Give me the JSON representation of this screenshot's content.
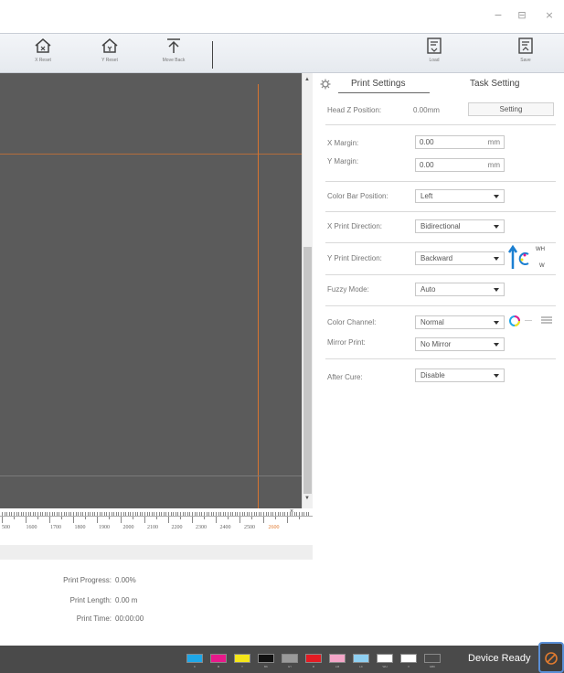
{
  "window": {
    "minimize": "−",
    "restore": "⊟",
    "close": "×"
  },
  "toolbar": {
    "x_reset": "X Reset",
    "y_reset": "Y Reset",
    "move_back": "Move Back",
    "load": "Load",
    "save": "Save"
  },
  "ruler": {
    "labels": [
      "500",
      "1600",
      "1700",
      "1800",
      "1900",
      "2000",
      "2100",
      "2200",
      "2300",
      "2400",
      "2500",
      "2600"
    ],
    "highlight": "2600"
  },
  "progress": {
    "print_progress_label": "Print Progress:",
    "print_progress_value": "0.00%",
    "print_length_label": "Print Length:",
    "print_length_value": "0.00 m",
    "print_time_label": "Print Time:",
    "print_time_value": "00:00:00"
  },
  "panel": {
    "tab_print_settings": "Print Settings",
    "tab_task_setting": "Task Setting",
    "head_z_label": "Head Z Position:",
    "head_z_value": "0.00mm",
    "setting_button": "Setting",
    "x_margin_label": "X Margin:",
    "x_margin_value": "0.00",
    "y_margin_label": "Y Margin:",
    "y_margin_value": "0.00",
    "unit_mm": "mm",
    "color_bar_label": "Color Bar Position:",
    "color_bar_value": "Left",
    "x_dir_label": "X Print Direction:",
    "x_dir_value": "Bidirectional",
    "y_dir_label": "Y Print Direction:",
    "y_dir_value": "Backward",
    "wh_label": "WH",
    "w_label": "W",
    "fuzzy_label": "Fuzzy Mode:",
    "fuzzy_value": "Auto",
    "color_channel_label": "Color Channel:",
    "color_channel_value": "Normal",
    "mirror_label": "Mirror Print:",
    "mirror_value": "No Mirror",
    "after_cure_label": "After Cure:",
    "after_cure_value": "Disable"
  },
  "status": {
    "device_ready": "Device Ready",
    "inks": [
      {
        "label": "C",
        "color": "#1ea7e8"
      },
      {
        "label": "M",
        "color": "#e8198b"
      },
      {
        "label": "Y",
        "color": "#f5e61a"
      },
      {
        "label": "BK",
        "color": "#111111"
      },
      {
        "label": "GY",
        "color": "#9a9a9a"
      },
      {
        "label": "R",
        "color": "#e31b23"
      },
      {
        "label": "LM",
        "color": "#f4a6c8"
      },
      {
        "label": "LC",
        "color": "#8fd0f2"
      },
      {
        "label": "WH",
        "color": "#ffffff"
      },
      {
        "label": "V",
        "color": "#ffffff"
      },
      {
        "label": "GBK",
        "color": "#4a4a4a"
      }
    ]
  },
  "colors": {
    "guide": "#d8752f",
    "canvas": "#5b5b5b",
    "status_bar": "#4a4a4a",
    "accent": "#5a8fd6"
  }
}
